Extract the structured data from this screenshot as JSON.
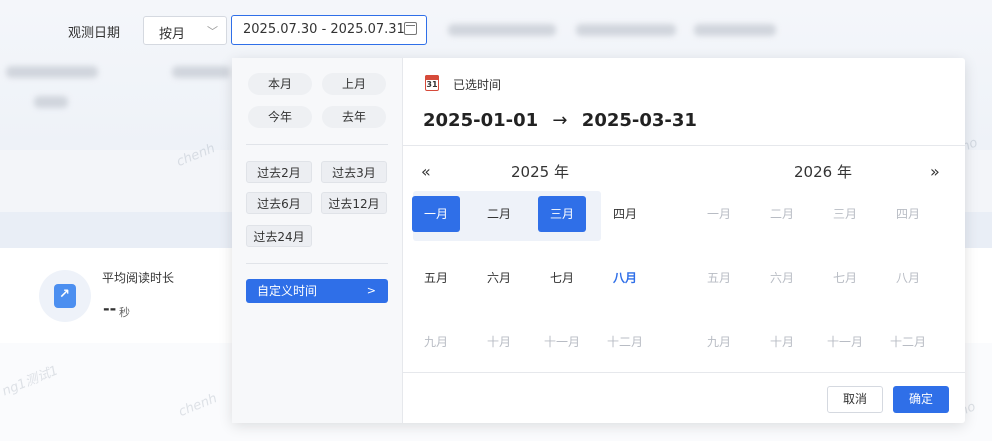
{
  "filter": {
    "label": "观测日期",
    "period_select": "按月",
    "date_range_value": "2025.07.30 - 2025.07.31"
  },
  "stat": {
    "title": "平均阅读时长",
    "value": "--",
    "unit": "秒"
  },
  "quick_options": {
    "row1": [
      "本月",
      "上月"
    ],
    "row2": [
      "今年",
      "去年"
    ],
    "past": [
      "过去2月",
      "过去3月",
      "过去6月",
      "过去12月",
      "过去24月"
    ],
    "custom_label": "自定义时间",
    "custom_arrow": ">"
  },
  "selected": {
    "label": "已选时间",
    "icon_text": "31",
    "start": "2025-01-01",
    "arrow": "→",
    "end": "2025-03-31"
  },
  "calendar": {
    "prev_nav": "«",
    "next_nav": "»",
    "left_year": "2025 年",
    "right_year": "2026 年",
    "months": [
      "一月",
      "二月",
      "三月",
      "四月",
      "五月",
      "六月",
      "七月",
      "八月",
      "九月",
      "十月",
      "十一月",
      "十二月"
    ]
  },
  "footer": {
    "cancel_label": "取消",
    "ok_label": "确定"
  },
  "colors": {
    "accent": "#2f6fe8",
    "disabled": "#b8bcc4",
    "range_bg": "#eef2f9"
  }
}
